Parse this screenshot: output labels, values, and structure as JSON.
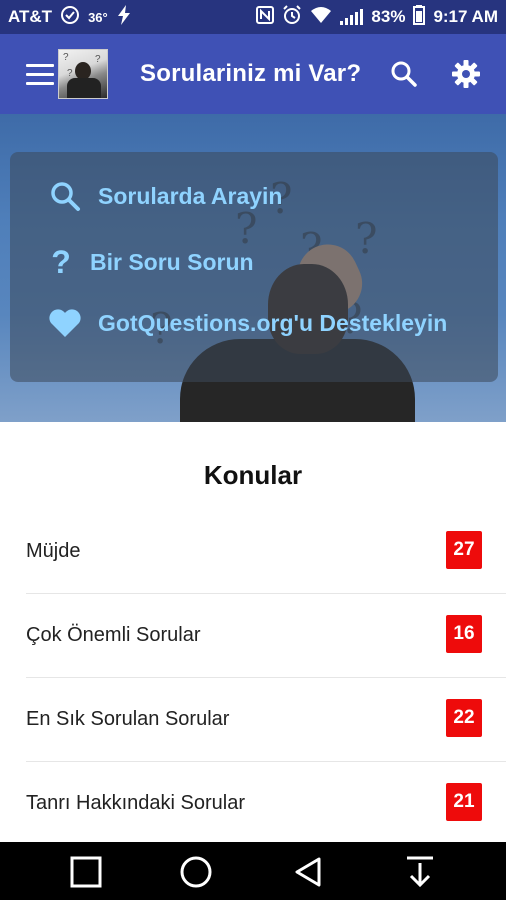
{
  "status_bar": {
    "carrier": "AT&T",
    "temperature": "36°",
    "battery": "83%",
    "time": "9:17 AM",
    "icons": [
      "check-circle-icon",
      "lightning-icon",
      "nfc-icon",
      "alarm-icon",
      "wifi-icon",
      "signal-icon",
      "battery-icon"
    ]
  },
  "app_bar": {
    "title": "Sorulariniz mi Var?",
    "icons": [
      "menu-icon",
      "search-icon",
      "gear-icon"
    ],
    "color": "#3f51b5"
  },
  "hero_card": {
    "items": [
      {
        "label": "Sorularda Arayin",
        "icon": "search-icon"
      },
      {
        "label": "Bir Soru Sorun",
        "icon": "question-icon"
      },
      {
        "label": "GotQuestions.org'u Destekleyin",
        "icon": "heart-icon"
      }
    ],
    "text_color": "#8fd3ff"
  },
  "topics": {
    "title": "Konular",
    "items": [
      {
        "label": "Müjde",
        "count": "27"
      },
      {
        "label": "Çok Önemli Sorular",
        "count": "16"
      },
      {
        "label": "En Sık Sorulan Sorular",
        "count": "22"
      },
      {
        "label": "Tanrı Hakkındaki Sorular",
        "count": "21"
      }
    ],
    "badge_color": "#ee0b0b"
  },
  "nav_bar": {
    "icons": [
      "recent-apps-icon",
      "home-icon",
      "back-icon",
      "download-icon"
    ]
  }
}
